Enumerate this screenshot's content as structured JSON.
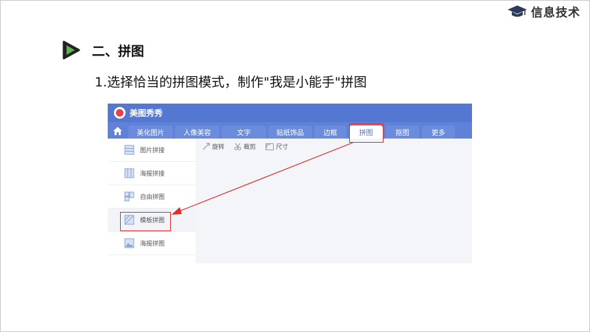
{
  "brand": {
    "text": "信息技术",
    "icon": "graduation-cap-icon"
  },
  "section": {
    "icon": "play-triangle-icon",
    "title": "二、拼图"
  },
  "instruction": "1.选择恰当的拼图模式，制作\"我是小能手\"拼图",
  "app": {
    "name": "美图秀秀",
    "home_icon": "home-icon",
    "tabs": [
      {
        "label": "美化图片",
        "active": false
      },
      {
        "label": "人像美容",
        "active": false
      },
      {
        "label": "文字",
        "active": false
      },
      {
        "label": "贴纸饰品",
        "active": false
      },
      {
        "label": "边框",
        "active": false
      },
      {
        "label": "拼图",
        "active": true
      },
      {
        "label": "抠图",
        "active": false
      },
      {
        "label": "更多",
        "active": false
      }
    ],
    "toolbar": [
      {
        "label": "旋转",
        "icon": "rotate-icon"
      },
      {
        "label": "裁剪",
        "icon": "scissors-icon"
      },
      {
        "label": "尺寸",
        "icon": "resize-icon"
      }
    ],
    "sidebar": [
      {
        "label": "图片拼接",
        "icon": "image-stitch-icon"
      },
      {
        "label": "海报拼接",
        "icon": "poster-stitch-icon"
      },
      {
        "label": "自由拼图",
        "icon": "free-collage-icon"
      },
      {
        "label": "模板拼图",
        "icon": "template-collage-icon",
        "active": true
      },
      {
        "label": "海报拼图",
        "icon": "poster-collage-icon"
      }
    ]
  },
  "colors": {
    "titlebar": "#5478d2",
    "tabbar": "#5f82d8",
    "highlight": "#e52a2a",
    "play_green": "#57b74a"
  }
}
